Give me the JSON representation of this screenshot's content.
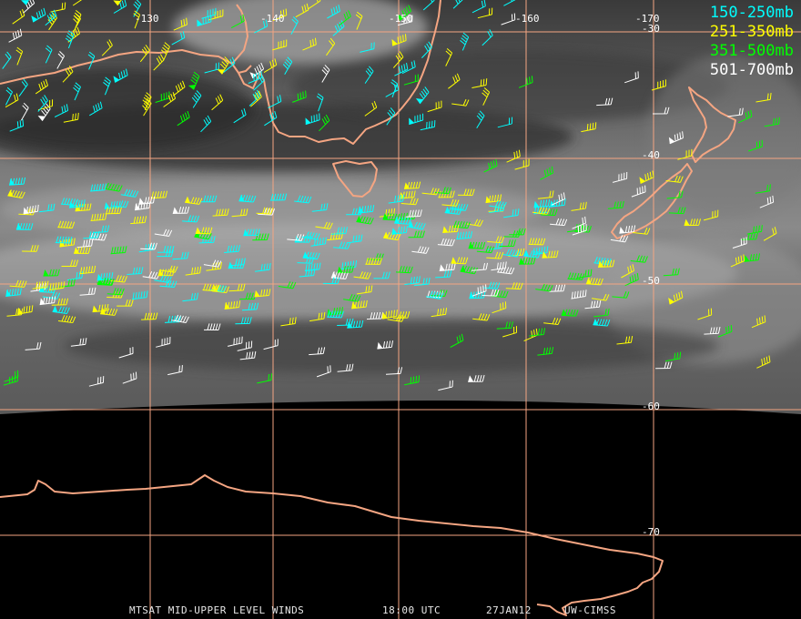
{
  "footer": {
    "product": "MTSAT MID-UPPER LEVEL WINDS",
    "time": "18:00 UTC",
    "date": "27JAN12",
    "source": "UW-CIMSS"
  },
  "legend": [
    {
      "label": "150-250mb",
      "color": "#00ffff"
    },
    {
      "label": "251-350mb",
      "color": "#ffff00"
    },
    {
      "label": "351-500mb",
      "color": "#00ff00"
    },
    {
      "label": "501-700mb",
      "color": "#ffffff"
    }
  ],
  "graticule": {
    "longitudes": [
      "-130",
      "-140",
      "-150",
      "-160",
      "-170"
    ],
    "latitudes": [
      "-30",
      "-40",
      "-50",
      "-60",
      "-70"
    ],
    "color": "#f4a582"
  },
  "coastline_color": "#f4a582",
  "features": {
    "landmasses": [
      "australia-coast",
      "tasmania-coast",
      "new-zealand-north-coast",
      "new-zealand-south-coast",
      "antarctica-coast"
    ],
    "overlay": "wind-barbs"
  }
}
